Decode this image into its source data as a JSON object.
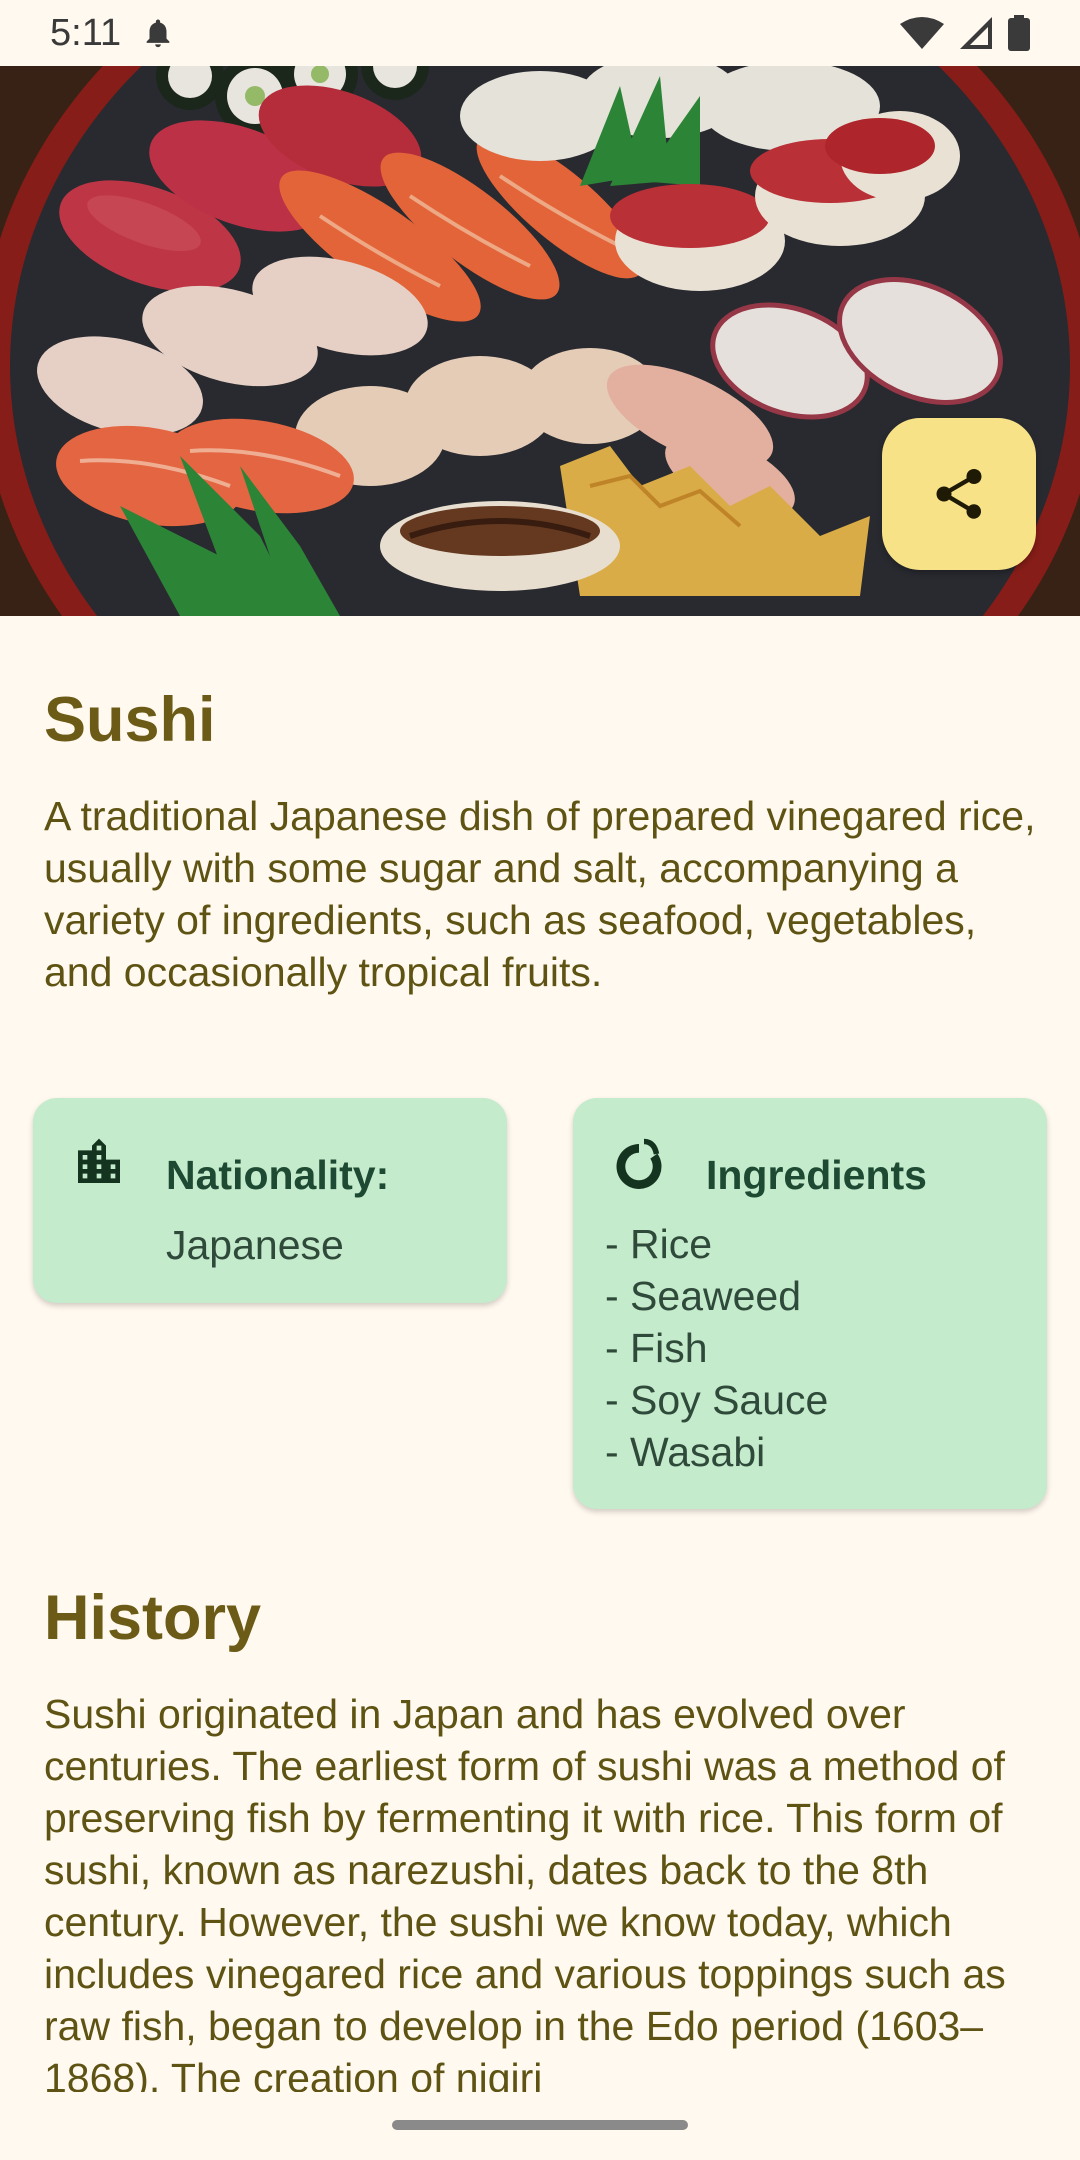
{
  "status_bar": {
    "time": "5:11",
    "icons": [
      "notification-bell-icon",
      "wifi-icon",
      "cell-signal-icon",
      "battery-icon"
    ]
  },
  "hero": {
    "image": "sushi-platter-photo"
  },
  "share_button": {
    "icon": "share-icon",
    "color": "#F8E287"
  },
  "dish": {
    "title": "Sushi",
    "description": "A traditional Japanese dish of prepared vinegared rice, usually with some sugar and salt, accompanying a variety of ingredients, such as seafood, vegetables, and occasionally tropical fruits."
  },
  "nationality_card": {
    "icon": "city-building-icon",
    "label": "Nationality:",
    "value": "Japanese"
  },
  "ingredients_card": {
    "icon": "ingredient-icon",
    "label": "Ingredients",
    "items": [
      "- Rice",
      "- Seaweed",
      "- Fish",
      "- Soy Sauce",
      "- Wasabi"
    ]
  },
  "history": {
    "title": "History",
    "text": "Sushi originated in Japan and has evolved over centuries. The earliest form of sushi was a method of preserving fish by fermenting it with rice. This form of sushi, known as narezushi, dates back to the 8th century. However, the sushi we know today, which includes vinegared rice and various toppings such as raw fish, began to develop in the Edo period (1603–1868). The creation of nigiri"
  },
  "colors": {
    "background": "#FFF9EF",
    "title": "#6B5B16",
    "body_text": "#5E5313",
    "card": "#C4EBCB",
    "card_heading": "#1E4A33",
    "share_fab": "#F8E287"
  }
}
